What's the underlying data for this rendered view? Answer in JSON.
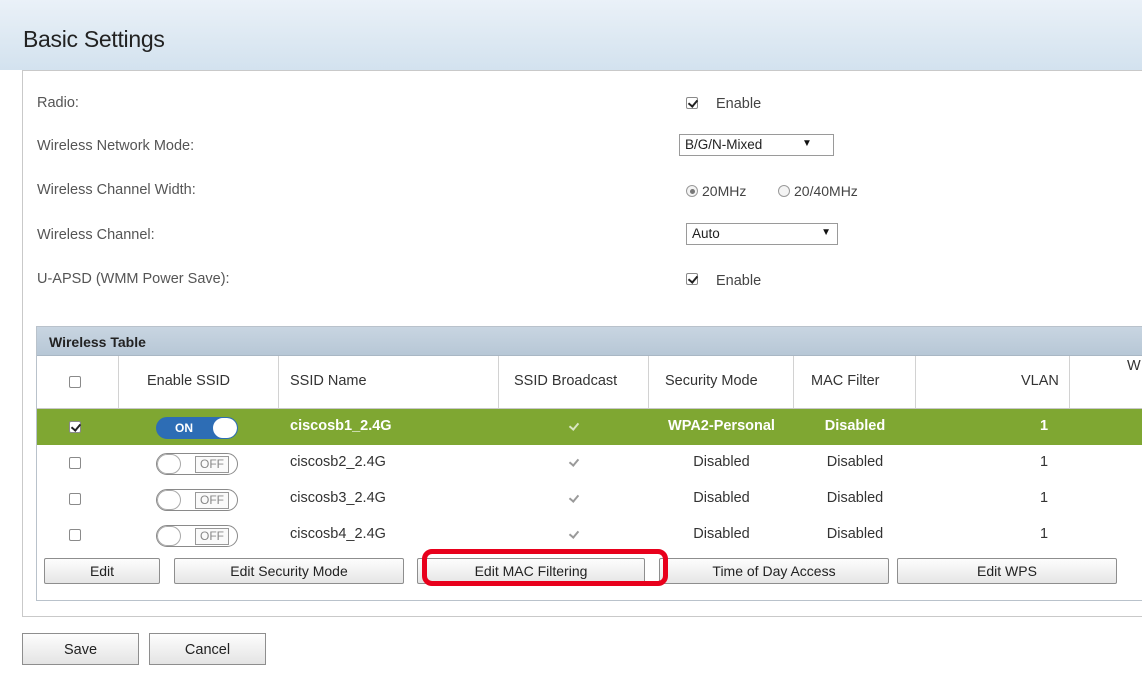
{
  "page": {
    "title": "Basic Settings"
  },
  "settings": {
    "radio": {
      "label": "Radio:",
      "checked": true,
      "option_label": "Enable"
    },
    "network_mode": {
      "label": "Wireless Network Mode:",
      "value": "B/G/N-Mixed"
    },
    "channel_width": {
      "label": "Wireless Channel Width:",
      "options": [
        "20MHz",
        "20/40MHz"
      ],
      "selected": "20MHz"
    },
    "channel": {
      "label": "Wireless Channel:",
      "value": "Auto"
    },
    "uapsd": {
      "label": "U-APSD (WMM Power Save):",
      "checked": true,
      "option_label": "Enable"
    }
  },
  "wireless_table": {
    "title": "Wireless Table",
    "columns": [
      "Enable SSID",
      "SSID Name",
      "SSID Broadcast",
      "Security Mode",
      "MAC Filter",
      "VLAN",
      "W"
    ],
    "rows": [
      {
        "selected": true,
        "enabled": true,
        "toggle_text": "ON",
        "ssid": "ciscosb1_2.4G",
        "broadcast": true,
        "security": "WPA2-Personal",
        "mac_filter": "Disabled",
        "vlan": "1"
      },
      {
        "selected": false,
        "enabled": false,
        "toggle_text": "OFF",
        "ssid": "ciscosb2_2.4G",
        "broadcast": true,
        "security": "Disabled",
        "mac_filter": "Disabled",
        "vlan": "1"
      },
      {
        "selected": false,
        "enabled": false,
        "toggle_text": "OFF",
        "ssid": "ciscosb3_2.4G",
        "broadcast": true,
        "security": "Disabled",
        "mac_filter": "Disabled",
        "vlan": "1"
      },
      {
        "selected": false,
        "enabled": false,
        "toggle_text": "OFF",
        "ssid": "ciscosb4_2.4G",
        "broadcast": true,
        "security": "Disabled",
        "mac_filter": "Disabled",
        "vlan": "1"
      }
    ],
    "buttons": {
      "edit": "Edit",
      "edit_security": "Edit Security Mode",
      "edit_mac": "Edit MAC Filtering",
      "time_of_day": "Time of Day Access",
      "edit_wps": "Edit WPS"
    }
  },
  "footer": {
    "save": "Save",
    "cancel": "Cancel"
  },
  "colors": {
    "selected_row": "#7fa732",
    "toggle_on": "#2d6db5",
    "highlight": "#e8001c"
  }
}
